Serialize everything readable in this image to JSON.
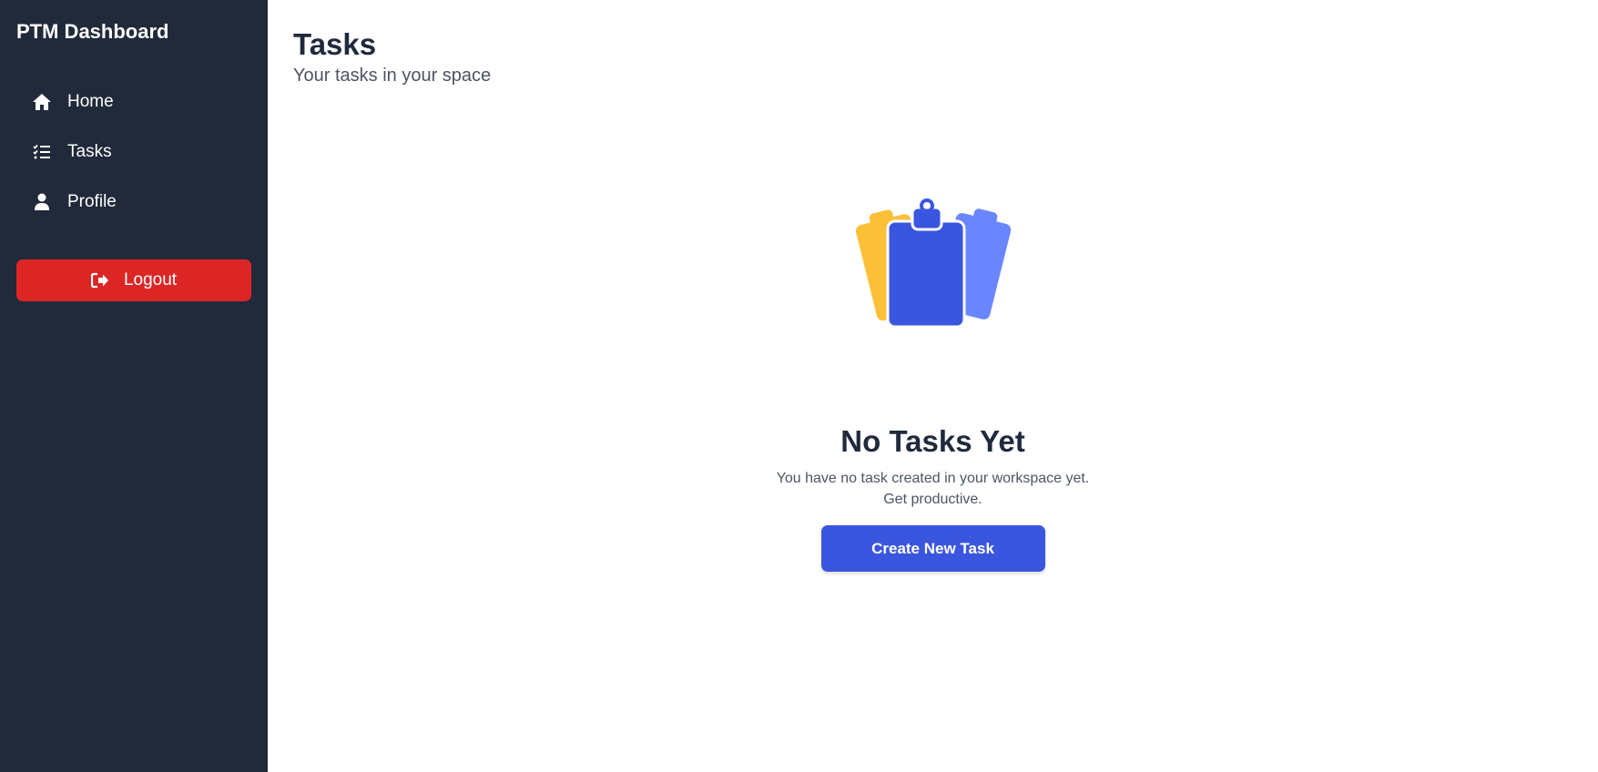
{
  "sidebar": {
    "brand": "PTM Dashboard",
    "items": [
      {
        "label": "Home",
        "icon": "home-icon"
      },
      {
        "label": "Tasks",
        "icon": "task-list-icon"
      },
      {
        "label": "Profile",
        "icon": "user-icon"
      }
    ],
    "logout": {
      "label": "Logout",
      "icon": "logout-icon"
    }
  },
  "header": {
    "title": "Tasks",
    "subtitle": "Your tasks in your space"
  },
  "empty_state": {
    "illustration": "clipboards-illustration",
    "title": "No Tasks Yet",
    "line1": "You have no task created in your workspace yet.",
    "line2": "Get productive.",
    "button_label": "Create New Task"
  },
  "colors": {
    "sidebar_bg": "#212a3a",
    "logout_bg": "#dc2626",
    "accent": "#3b56de",
    "illustration_yellow": "#fbbf38",
    "illustration_light_blue": "#6a86ff"
  }
}
